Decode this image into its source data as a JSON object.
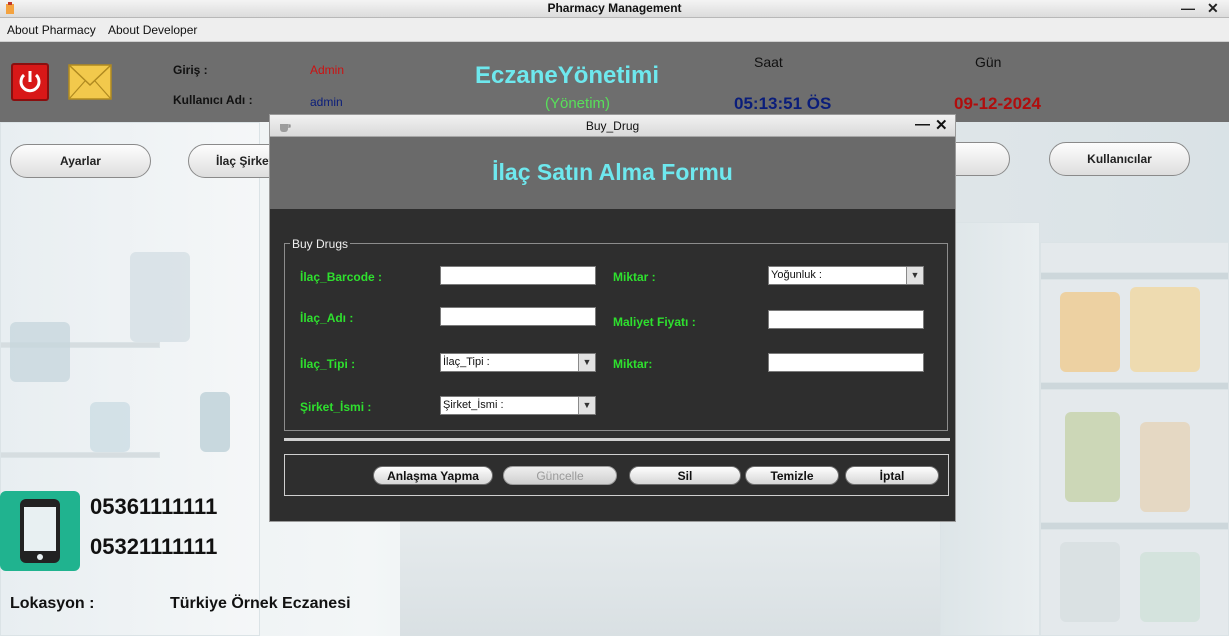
{
  "window": {
    "title": "Pharmacy Management",
    "minimize": "—",
    "close": "✕"
  },
  "menu": [
    "About Pharmacy",
    "About Developer"
  ],
  "header": {
    "login_label": "Giriş :",
    "login_value": "Admin",
    "username_label": "Kullanıcı Adı :",
    "username_value": "admin",
    "brand": "EczaneYönetimi",
    "role": "(Yönetim)",
    "time_label": "Saat",
    "time_value": "05:13:51 ÖS",
    "date_label": "Gün",
    "date_value": "09-12-2024"
  },
  "nav": {
    "settings": "Ayarlar",
    "companies": "İlaç Şirket",
    "users": "Kullanıcılar"
  },
  "contact": {
    "phones": [
      "05361111111",
      "05321111111"
    ],
    "location_label": "Lokasyon :",
    "location_value": "Türkiye Örnek Eczanesi"
  },
  "dialog": {
    "title": "Buy_Drug",
    "minimize": "—",
    "close": "✕",
    "form_title": "İlaç Satın Alma  Formu",
    "group": "Buy Drugs",
    "fields": {
      "barcode": "İlaç_Barcode :",
      "name": "İlaç_Adı :",
      "type": "İlaç_Tipi :",
      "company": "Şirket_İsmi :",
      "amount": "Miktar :",
      "cost": "Maliyet Fiyatı :",
      "quantity": "Miktar:"
    },
    "combos": {
      "density": "Yoğunluk :",
      "type": "İlaç_Tipi :",
      "company": "Şirket_İsmi :"
    },
    "buttons": {
      "deal": "Anlaşma Yapma",
      "update": "Güncelle",
      "delete": "Sil",
      "clear": "Temizle",
      "cancel": "İptal"
    }
  },
  "colors": {
    "accent_cyan": "#6ee8ee",
    "field_green": "#2ee02e",
    "admin_red": "#cc1111",
    "admin_blue": "#0a1d7a",
    "date_red": "#b00d0d"
  }
}
